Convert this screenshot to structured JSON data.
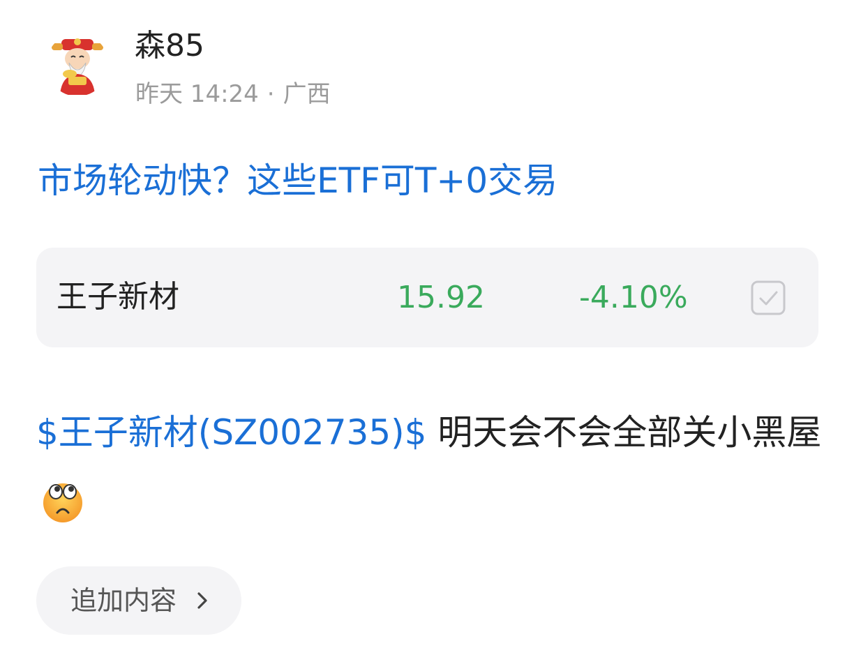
{
  "author": {
    "name": "森85",
    "avatar_icon": "fortune-god-avatar"
  },
  "meta": {
    "time": "昨天 14:24",
    "separator": "·",
    "location": "广西"
  },
  "title": "市场轮动快？这些ETF可T+0交易",
  "stock_card": {
    "name": "王子新材",
    "price": "15.92",
    "change": "-4.10%",
    "checkbox_icon": "checkbox-check-icon"
  },
  "body": {
    "cashtag": "$王子新材(SZ002735)$",
    "text": " 明天会不会全部关小黑屋",
    "emoji_icon": "eyes-rolling-emoji-icon"
  },
  "add_content_button": {
    "label": "追加内容",
    "icon": "chevron-right-icon"
  },
  "colors": {
    "link_blue": "#1a6fd6",
    "down_green": "#3aaa5c",
    "card_bg": "#f4f4f6",
    "muted_text": "#9b9b9b",
    "primary_text": "#222222"
  }
}
